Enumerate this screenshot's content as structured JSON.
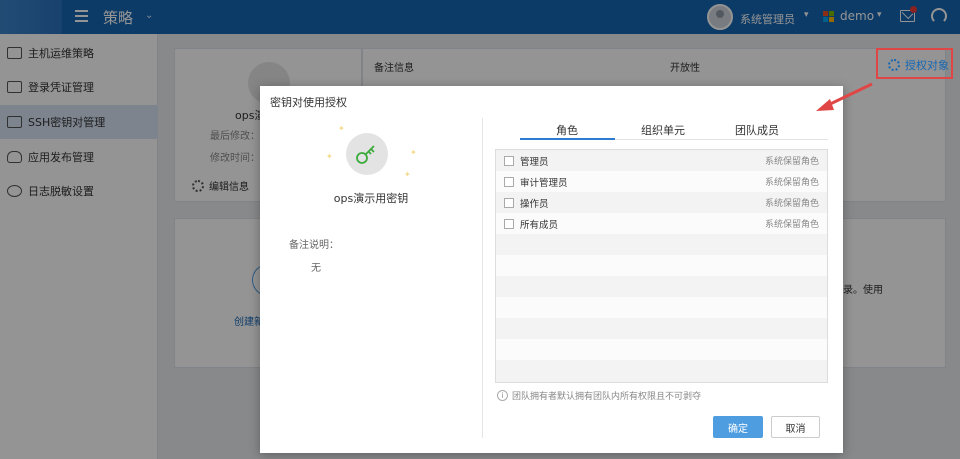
{
  "topbar": {
    "app_title": "策略",
    "user_name": "系统管理员",
    "org_name": "demo"
  },
  "sidebar": {
    "items": [
      {
        "label": "主机运维策略"
      },
      {
        "label": "登录凭证管理"
      },
      {
        "label": "SSH密钥对管理"
      },
      {
        "label": "应用发布管理"
      },
      {
        "label": "日志脱敏设置"
      }
    ]
  },
  "background": {
    "key_name_partial": "ops演",
    "last_modified_label": "最后修改：",
    "modified_time_label": "修改时间：",
    "edit_info": "编辑信息",
    "remark_header": "备注信息",
    "openness_header": "开放性",
    "authorize_link": "授权对象",
    "create_partial": "创建新",
    "right_text_partial": "录。使用"
  },
  "modal": {
    "title": "密钥对使用授权",
    "key_name": "ops演示用密钥",
    "remark_label": "备注说明：",
    "remark_value": "无",
    "tabs": [
      {
        "label": "角色"
      },
      {
        "label": "组织单元"
      },
      {
        "label": "团队成员"
      }
    ],
    "roles": [
      {
        "name": "管理员",
        "tag": "系统保留角色"
      },
      {
        "name": "审计管理员",
        "tag": "系统保留角色"
      },
      {
        "name": "操作员",
        "tag": "系统保留角色"
      },
      {
        "name": "所有成员",
        "tag": "系统保留角色"
      }
    ],
    "hint": "团队拥有者默认拥有团队内所有权限且不可剥夺",
    "ok_label": "确定",
    "cancel_label": "取消"
  },
  "colors": {
    "topbar": "#1667b3",
    "primary_button": "#4d9de0",
    "highlight_red": "#e04646",
    "key_green": "#3cab3c"
  }
}
